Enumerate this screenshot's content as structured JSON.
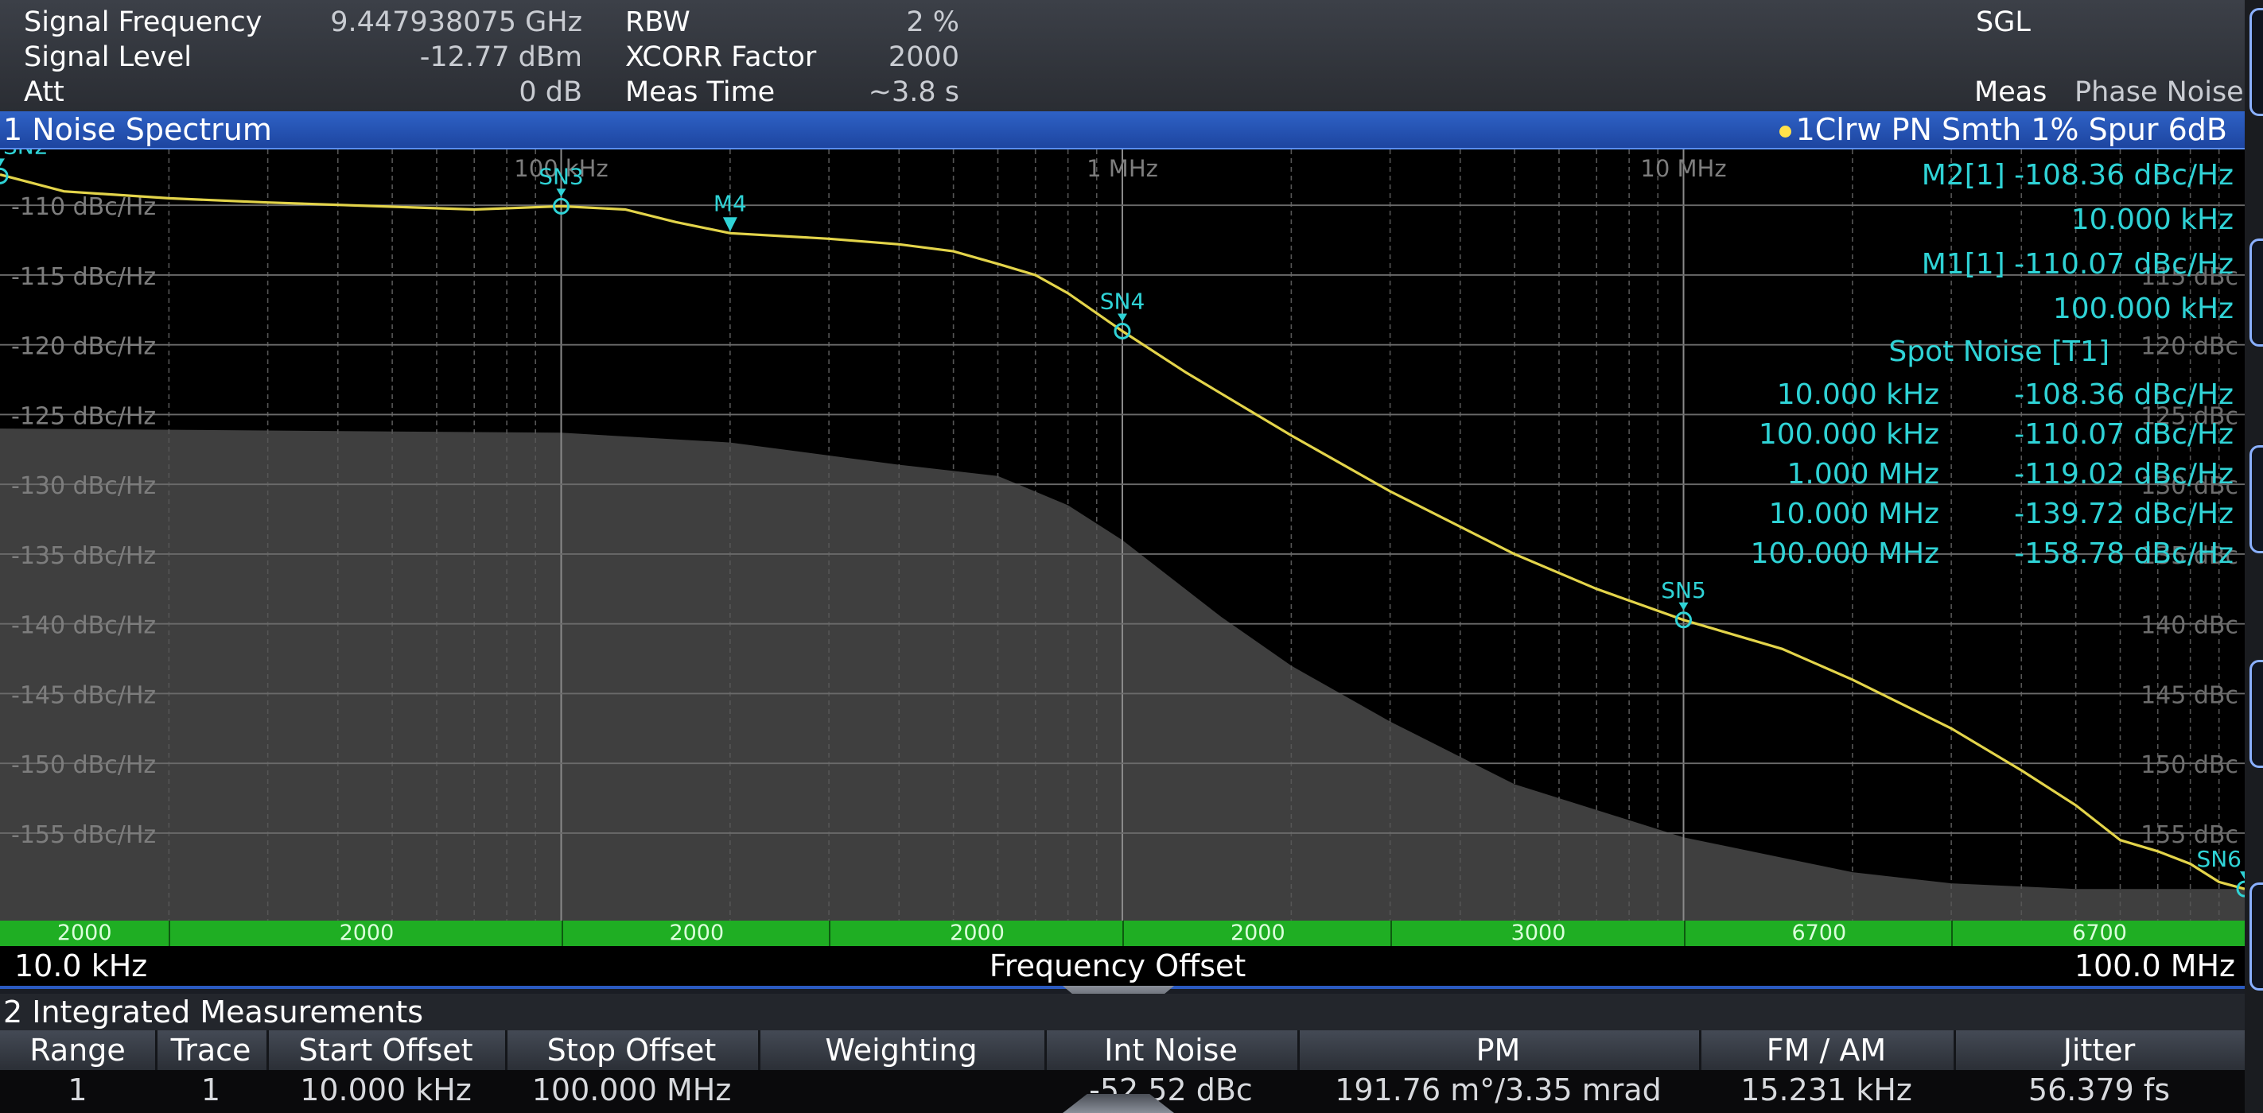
{
  "header": {
    "signal_frequency_label": "Signal Frequency",
    "signal_frequency_value": "9.447938075 GHz",
    "signal_level_label": "Signal Level",
    "signal_level_value": "-12.77 dBm",
    "att_label": "Att",
    "att_value": "0 dB",
    "rbw_label": "RBW",
    "rbw_value": "2 %",
    "xcorr_label": "XCORR Factor",
    "xcorr_value": "2000",
    "meas_time_label": "Meas Time",
    "meas_time_value": "~3.8 s",
    "sgl": "SGL",
    "meas_label": "Meas",
    "meas_value": "Phase Noise"
  },
  "window1": {
    "title": "1 Noise Spectrum",
    "trace_info": "1Clrw PN Smth 1% Spur 6dB"
  },
  "colors": {
    "trace": "#e3d44a",
    "marker": "#2fd3d6",
    "grid": "#5e5e5e",
    "fill": "#3f3f3f",
    "green": "#1fae23",
    "title_blue": "#1f4fb0"
  },
  "chart_data": {
    "type": "line",
    "x_scale": "log",
    "xlim_hz": [
      10000,
      100000000
    ],
    "ylim": [
      -160,
      -106
    ],
    "y_ticks": [
      -110,
      -115,
      -120,
      -125,
      -130,
      -135,
      -140,
      -145,
      -150,
      -155
    ],
    "y_tick_labels_left": [
      "-110 dBc/Hz",
      "-115 dBc/Hz",
      "-120 dBc/Hz",
      "-125 dBc/Hz",
      "-130 dBc/Hz",
      "-135 dBc/Hz",
      "-140 dBc/Hz",
      "-145 dBc/Hz",
      "-150 dBc/Hz",
      "-155 dBc/Hz"
    ],
    "y_tick_labels_right": [
      "",
      "115 dBc",
      "120 dBc",
      "125 dBc",
      "130 dBc",
      "135 dBc",
      "140 dBc",
      "145 dBc",
      "150 dBc",
      "155 dBc"
    ],
    "x_decade_labels": [
      {
        "hz": 100000,
        "label": "100 kHz"
      },
      {
        "hz": 1000000,
        "label": "1 MHz"
      },
      {
        "hz": 10000000,
        "label": "10 MHz"
      }
    ],
    "xlabel": "Frequency Offset",
    "x_start_label": "10.0 kHz",
    "x_stop_label": "100.0 MHz",
    "trace": [
      [
        10000,
        -107.8
      ],
      [
        13000,
        -109.0
      ],
      [
        20000,
        -109.5
      ],
      [
        30000,
        -109.8
      ],
      [
        50000,
        -110.1
      ],
      [
        70000,
        -110.3
      ],
      [
        100000,
        -110.07
      ],
      [
        130000,
        -110.3
      ],
      [
        160000,
        -111.2
      ],
      [
        200000,
        -112.0
      ],
      [
        300000,
        -112.4
      ],
      [
        400000,
        -112.8
      ],
      [
        500000,
        -113.3
      ],
      [
        600000,
        -114.2
      ],
      [
        700000,
        -115.0
      ],
      [
        800000,
        -116.3
      ],
      [
        1000000,
        -119.02
      ],
      [
        1300000,
        -122.0
      ],
      [
        2000000,
        -126.5
      ],
      [
        3000000,
        -130.5
      ],
      [
        5000000,
        -135.0
      ],
      [
        7000000,
        -137.5
      ],
      [
        10000000,
        -139.72
      ],
      [
        15000000,
        -141.8
      ],
      [
        20000000,
        -144.0
      ],
      [
        30000000,
        -147.5
      ],
      [
        40000000,
        -150.5
      ],
      [
        50000000,
        -153.0
      ],
      [
        60000000,
        -155.5
      ],
      [
        70000000,
        -156.3
      ],
      [
        80000000,
        -157.2
      ],
      [
        90000000,
        -158.5
      ],
      [
        100000000,
        -159.0
      ]
    ],
    "noise_floor": [
      [
        10000,
        -126.0
      ],
      [
        100000,
        -126.3
      ],
      [
        200000,
        -127.0
      ],
      [
        400000,
        -128.6
      ],
      [
        600000,
        -129.4
      ],
      [
        800000,
        -131.5
      ],
      [
        1000000,
        -134.0
      ],
      [
        1500000,
        -139.5
      ],
      [
        2000000,
        -143.0
      ],
      [
        3000000,
        -147.0
      ],
      [
        5000000,
        -151.5
      ],
      [
        10000000,
        -155.3
      ],
      [
        20000000,
        -157.8
      ],
      [
        30000000,
        -158.6
      ],
      [
        50000000,
        -159.0
      ],
      [
        100000000,
        -159.0
      ]
    ],
    "markers": [
      {
        "name": "SN2",
        "hz": 10000,
        "db": -107.9,
        "type": "circle"
      },
      {
        "name": "SN3",
        "hz": 100000,
        "db": -110.07,
        "type": "circle"
      },
      {
        "name": "M4",
        "hz": 200000,
        "db": -112.0,
        "type": "triangle"
      },
      {
        "name": "SN4",
        "hz": 1000000,
        "db": -119.02,
        "type": "circle"
      },
      {
        "name": "SN5",
        "hz": 10000000,
        "db": -139.72,
        "type": "circle"
      },
      {
        "name": "SN6",
        "hz": 100000000,
        "db": -159.0,
        "type": "circle"
      }
    ],
    "marker_table": [
      {
        "label": "M2[1]",
        "value": "-108.36 dBc/Hz"
      },
      {
        "label": "",
        "value": "10.000 kHz"
      },
      {
        "label": "M1[1]",
        "value": "-110.07 dBc/Hz"
      },
      {
        "label": "",
        "value": "100.000 kHz"
      }
    ],
    "spot_noise_title": "Spot Noise [T1]",
    "spot_noise": [
      {
        "offset": "10.000 kHz",
        "value": "-108.36 dBc/Hz"
      },
      {
        "offset": "100.000 kHz",
        "value": "-110.07 dBc/Hz"
      },
      {
        "offset": "1.000 MHz",
        "value": "-119.02 dBc/Hz"
      },
      {
        "offset": "10.000 MHz",
        "value": "-139.72 dBc/Hz"
      },
      {
        "offset": "100.000 MHz",
        "value": "-158.78 dBc/Hz"
      }
    ],
    "xcorr_segments": [
      {
        "from_hz": 10000,
        "to_hz": 20000,
        "label": "2000"
      },
      {
        "from_hz": 20000,
        "to_hz": 100000,
        "label": "2000"
      },
      {
        "from_hz": 100000,
        "to_hz": 300000,
        "label": "2000"
      },
      {
        "from_hz": 300000,
        "to_hz": 1000000,
        "label": "2000"
      },
      {
        "from_hz": 1000000,
        "to_hz": 3000000,
        "label": "2000"
      },
      {
        "from_hz": 3000000,
        "to_hz": 10000000,
        "label": "3000"
      },
      {
        "from_hz": 10000000,
        "to_hz": 30000000,
        "label": "6700"
      },
      {
        "from_hz": 30000000,
        "to_hz": 100000000,
        "label": "6700"
      }
    ]
  },
  "window2": {
    "title": "2 Integrated Measurements",
    "columns": [
      "Range",
      "Trace",
      "Start Offset",
      "Stop Offset",
      "Weighting",
      "Int Noise",
      "PM",
      "FM / AM",
      "Jitter"
    ],
    "rows": [
      [
        "1",
        "1",
        "10.000 kHz",
        "100.000 MHz",
        "",
        "-52.52 dBc",
        "191.76 m°/3.35 mrad",
        "15.231 kHz",
        "56.379 fs"
      ]
    ]
  }
}
